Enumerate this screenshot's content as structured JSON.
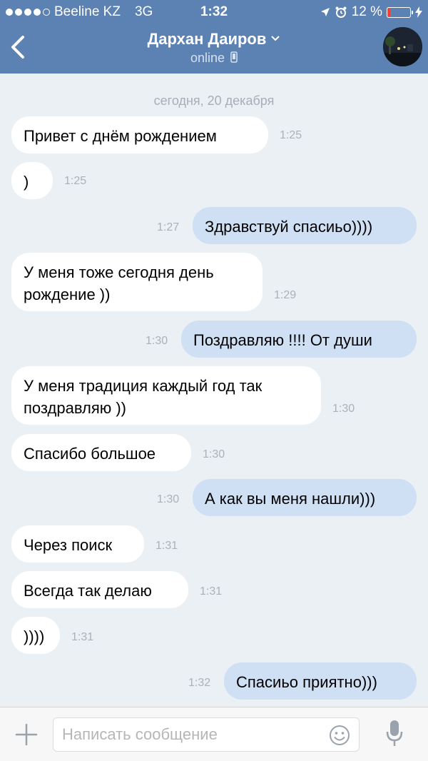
{
  "status_bar": {
    "carrier": "Beeline KZ",
    "network": "3G",
    "time": "1:32",
    "battery": "12 %",
    "battery_level": 0.12
  },
  "header": {
    "contact_name": "Дархан Даиров",
    "status": "online"
  },
  "chat": {
    "date_separator": "сегодня, 20 декабря",
    "messages": [
      {
        "dir": "in",
        "text": "Привет с днём рождением",
        "time": "1:25"
      },
      {
        "dir": "in",
        "text": ")",
        "time": "1:25"
      },
      {
        "dir": "out",
        "text": "Здравствуй спасиьо))))",
        "time": "1:27"
      },
      {
        "dir": "in",
        "text": "У меня тоже сегодня день рождение ))",
        "time": "1:29"
      },
      {
        "dir": "out",
        "text": "Поздравляю !!!! От души",
        "time": "1:30"
      },
      {
        "dir": "in",
        "text": "У меня традиция каждый год так поздравляю ))",
        "time": "1:30"
      },
      {
        "dir": "in",
        "text": "Спасибо большое",
        "time": "1:30"
      },
      {
        "dir": "out",
        "text": "А как вы меня нашли)))",
        "time": "1:30"
      },
      {
        "dir": "in",
        "text": "Через поиск",
        "time": "1:31"
      },
      {
        "dir": "in",
        "text": "Всегда так делаю",
        "time": "1:31"
      },
      {
        "dir": "in",
        "text": "))))",
        "time": "1:31"
      },
      {
        "dir": "out",
        "text": "Спасиьо приятно)))",
        "time": "1:32"
      }
    ]
  },
  "input": {
    "placeholder": "Написать сообщение"
  },
  "colors": {
    "header_bg": "#5b82b3",
    "chat_bg": "#ebf0f5",
    "incoming_bubble": "#ffffff",
    "outgoing_bubble": "#cfe0f4"
  }
}
